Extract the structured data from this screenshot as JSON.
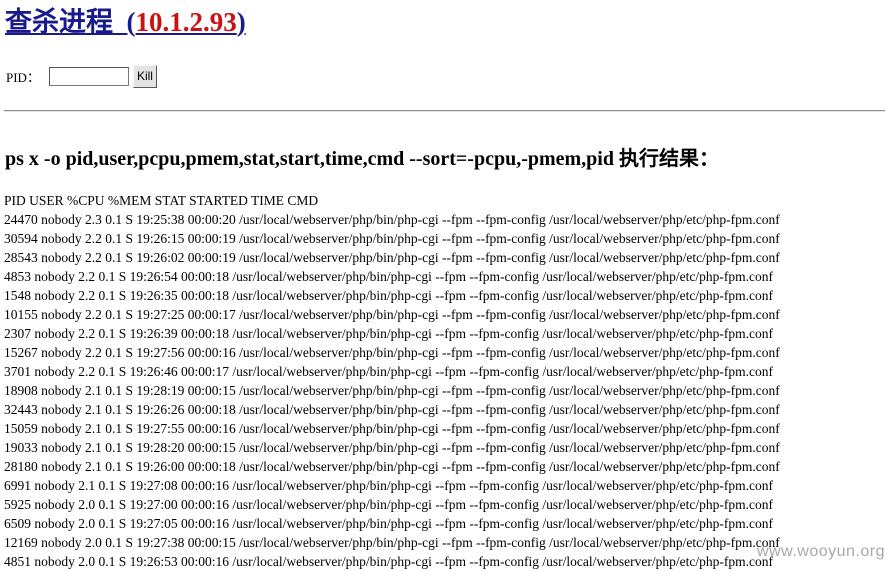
{
  "header": {
    "title": "查杀进程",
    "ip_open": "(",
    "ip": "10.1.2.93",
    "ip_close": ")"
  },
  "form": {
    "pid_label": "PID：",
    "pid_value": "",
    "kill_label": "Kill"
  },
  "command_heading": "ps x -o pid,user,pcpu,pmem,stat,start,time,cmd --sort=-pcpu,-pmem,pid 执行结果：",
  "output": {
    "header_line": "PID USER %CPU %MEM STAT STARTED TIME CMD",
    "rows": [
      "24470 nobody 2.3 0.1 S 19:25:38 00:00:20 /usr/local/webserver/php/bin/php-cgi --fpm --fpm-config /usr/local/webserver/php/etc/php-fpm.conf",
      "30594 nobody 2.2 0.1 S 19:26:15 00:00:19 /usr/local/webserver/php/bin/php-cgi --fpm --fpm-config /usr/local/webserver/php/etc/php-fpm.conf",
      "28543 nobody 2.2 0.1 S 19:26:02 00:00:19 /usr/local/webserver/php/bin/php-cgi --fpm --fpm-config /usr/local/webserver/php/etc/php-fpm.conf",
      "4853 nobody 2.2 0.1 S 19:26:54 00:00:18 /usr/local/webserver/php/bin/php-cgi --fpm --fpm-config /usr/local/webserver/php/etc/php-fpm.conf",
      "1548 nobody 2.2 0.1 S 19:26:35 00:00:18 /usr/local/webserver/php/bin/php-cgi --fpm --fpm-config /usr/local/webserver/php/etc/php-fpm.conf",
      "10155 nobody 2.2 0.1 S 19:27:25 00:00:17 /usr/local/webserver/php/bin/php-cgi --fpm --fpm-config /usr/local/webserver/php/etc/php-fpm.conf",
      "2307 nobody 2.2 0.1 S 19:26:39 00:00:18 /usr/local/webserver/php/bin/php-cgi --fpm --fpm-config /usr/local/webserver/php/etc/php-fpm.conf",
      "15267 nobody 2.2 0.1 S 19:27:56 00:00:16 /usr/local/webserver/php/bin/php-cgi --fpm --fpm-config /usr/local/webserver/php/etc/php-fpm.conf",
      "3701 nobody 2.2 0.1 S 19:26:46 00:00:17 /usr/local/webserver/php/bin/php-cgi --fpm --fpm-config /usr/local/webserver/php/etc/php-fpm.conf",
      "18908 nobody 2.1 0.1 S 19:28:19 00:00:15 /usr/local/webserver/php/bin/php-cgi --fpm --fpm-config /usr/local/webserver/php/etc/php-fpm.conf",
      "32443 nobody 2.1 0.1 S 19:26:26 00:00:18 /usr/local/webserver/php/bin/php-cgi --fpm --fpm-config /usr/local/webserver/php/etc/php-fpm.conf",
      "15059 nobody 2.1 0.1 S 19:27:55 00:00:16 /usr/local/webserver/php/bin/php-cgi --fpm --fpm-config /usr/local/webserver/php/etc/php-fpm.conf",
      "19033 nobody 2.1 0.1 S 19:28:20 00:00:15 /usr/local/webserver/php/bin/php-cgi --fpm --fpm-config /usr/local/webserver/php/etc/php-fpm.conf",
      "28180 nobody 2.1 0.1 S 19:26:00 00:00:18 /usr/local/webserver/php/bin/php-cgi --fpm --fpm-config /usr/local/webserver/php/etc/php-fpm.conf",
      "6991 nobody 2.1 0.1 S 19:27:08 00:00:16 /usr/local/webserver/php/bin/php-cgi --fpm --fpm-config /usr/local/webserver/php/etc/php-fpm.conf",
      "5925 nobody 2.0 0.1 S 19:27:00 00:00:16 /usr/local/webserver/php/bin/php-cgi --fpm --fpm-config /usr/local/webserver/php/etc/php-fpm.conf",
      "6509 nobody 2.0 0.1 S 19:27:05 00:00:16 /usr/local/webserver/php/bin/php-cgi --fpm --fpm-config /usr/local/webserver/php/etc/php-fpm.conf",
      "12169 nobody 2.0 0.1 S 19:27:38 00:00:15 /usr/local/webserver/php/bin/php-cgi --fpm --fpm-config /usr/local/webserver/php/etc/php-fpm.conf",
      "4851 nobody 2.0 0.1 S 19:26:53 00:00:16 /usr/local/webserver/php/bin/php-cgi --fpm --fpm-config /usr/local/webserver/php/etc/php-fpm.conf"
    ]
  },
  "watermark": "www.wooyun.org",
  "colors": {
    "title_link": "#1a1a8c",
    "ip_text": "#cc1111",
    "watermark": "#a8a8a8"
  }
}
